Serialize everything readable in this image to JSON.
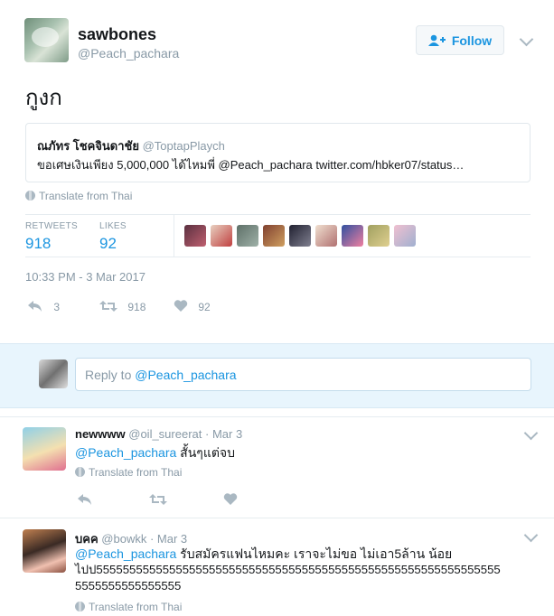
{
  "tweet": {
    "author_name": "sawbones",
    "author_handle": "@Peach_pachara",
    "follow_label": "Follow",
    "text": "กูงก",
    "translate_label": "Translate from Thai",
    "retweets_label": "RETWEETS",
    "retweets": "918",
    "likes_label": "LIKES",
    "likes": "92",
    "timestamp": "10:33 PM - 3 Mar 2017",
    "reply_count": "3",
    "retweet_count": "918",
    "like_count": "92"
  },
  "quoted": {
    "name": "ณภัทร โชคจินดาชัย",
    "handle": "@ToptapPlaych",
    "text": "ขอเศษเงินเพียง 5,000,000 ได้ไหมพี่ @Peach_pachara twitter.com/hbker07/status…"
  },
  "composer": {
    "prefix": "Reply to ",
    "mention": "@Peach_pachara"
  },
  "replies": [
    {
      "name": "newwww",
      "handle": "@oil_sureerat",
      "date": "· Mar 3",
      "mention": "@Peach_pachara",
      "text": " สั้นๆแต่จบ",
      "translate": "Translate from Thai"
    },
    {
      "name": "บคค",
      "handle": "@bowkk",
      "date": "· Mar 3",
      "mention": "@Peach_pachara",
      "text_line1": " รับสมัครแฟนไหมคะ เราจะไม่ขอ ไม่เอา5ล้าน น้อย",
      "text_line2": "ไปป5555555555555555555555555555555555555555555555555555555555555",
      "text_line3": "5555555555555555",
      "translate": "Translate from Thai"
    }
  ],
  "colors": {
    "accent": "#1b95e0",
    "muted": "#8899a6",
    "reply_bg": "#e8f5fd"
  }
}
